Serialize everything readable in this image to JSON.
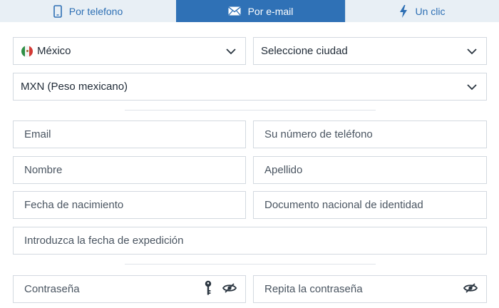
{
  "tabs": [
    {
      "label": "Por telefono",
      "icon": "phone-icon",
      "active": false
    },
    {
      "label": "Por e-mail",
      "icon": "envelope-icon",
      "active": true
    },
    {
      "label": "Un clic",
      "icon": "lightning-icon",
      "active": false
    }
  ],
  "country": {
    "value": "México",
    "flag": "mexico-flag-icon"
  },
  "city": {
    "placeholder": "Seleccione ciudad"
  },
  "currency": {
    "value": "MXN (Peso mexicano)"
  },
  "fields": {
    "email": "Email",
    "phone": "Su número de teléfono",
    "first_name": "Nombre",
    "last_name": "Apellido",
    "birth_date": "Fecha de nacimiento",
    "national_id": "Documento nacional de identidad",
    "issue_date": "Introduzca la fecha de expedición",
    "password": "Contraseña",
    "password_repeat": "Repita la contraseña"
  },
  "colors": {
    "accent": "#2f71b6",
    "tab_bg": "#e8eff5",
    "border": "#d3d9e0"
  }
}
